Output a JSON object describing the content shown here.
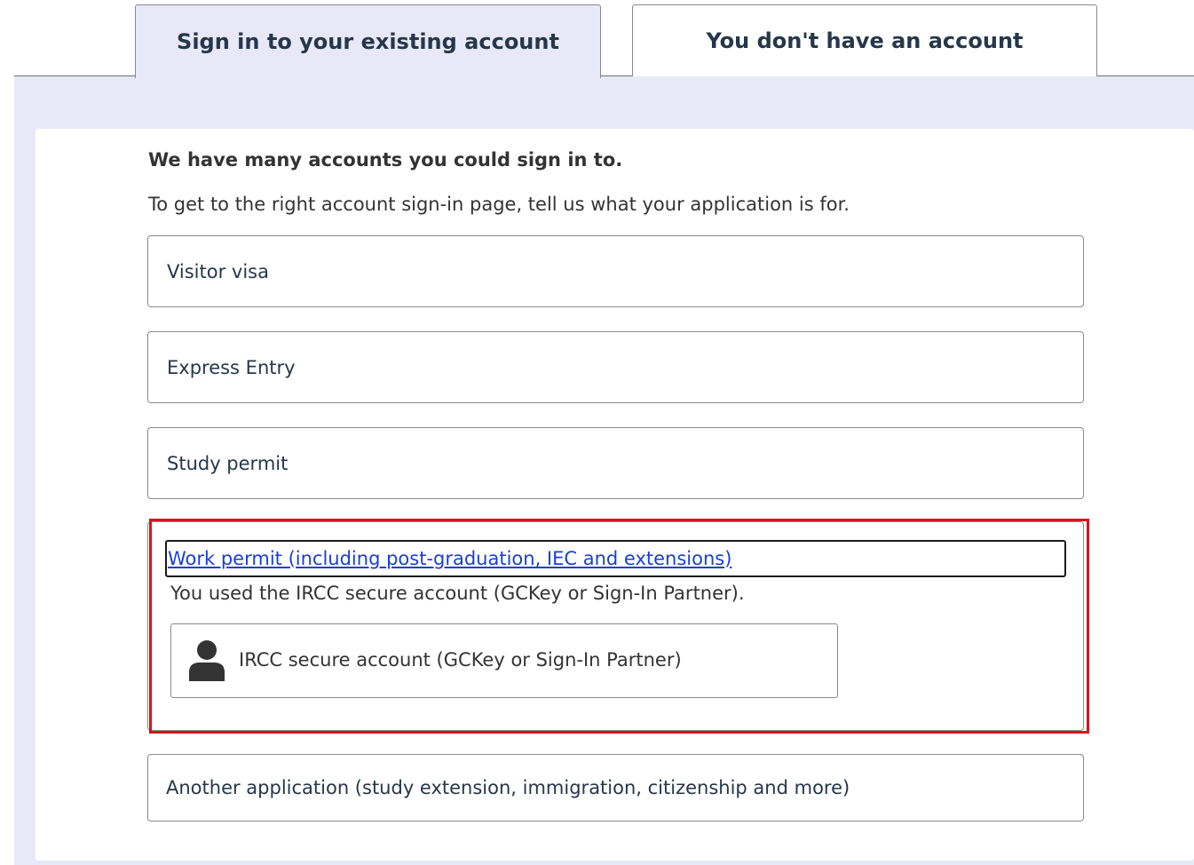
{
  "tabs": {
    "sign_in": "Sign in to your existing account",
    "no_account": "You don't have an account"
  },
  "content": {
    "heading": "We have many accounts you could sign in to.",
    "intro": "To get to the right account sign-in page, tell us what your application is for."
  },
  "options": {
    "visitor_visa": "Visitor visa",
    "express_entry": "Express Entry",
    "study_permit": "Study permit",
    "work_permit": "Work permit (including post-graduation, IEC and extensions)",
    "another": "Another application (study extension, immigration, citizenship and more)"
  },
  "work_permit_detail": {
    "used_text": "You used the IRCC secure account (GCKey or Sign-In Partner).",
    "account_button": "IRCC secure account (GCKey or Sign-In Partner)",
    "account_icon": "person-icon"
  },
  "colors": {
    "tab_active_bg": "#e8e8f8",
    "highlight": "#e0101e",
    "link": "#1a3fd6"
  }
}
